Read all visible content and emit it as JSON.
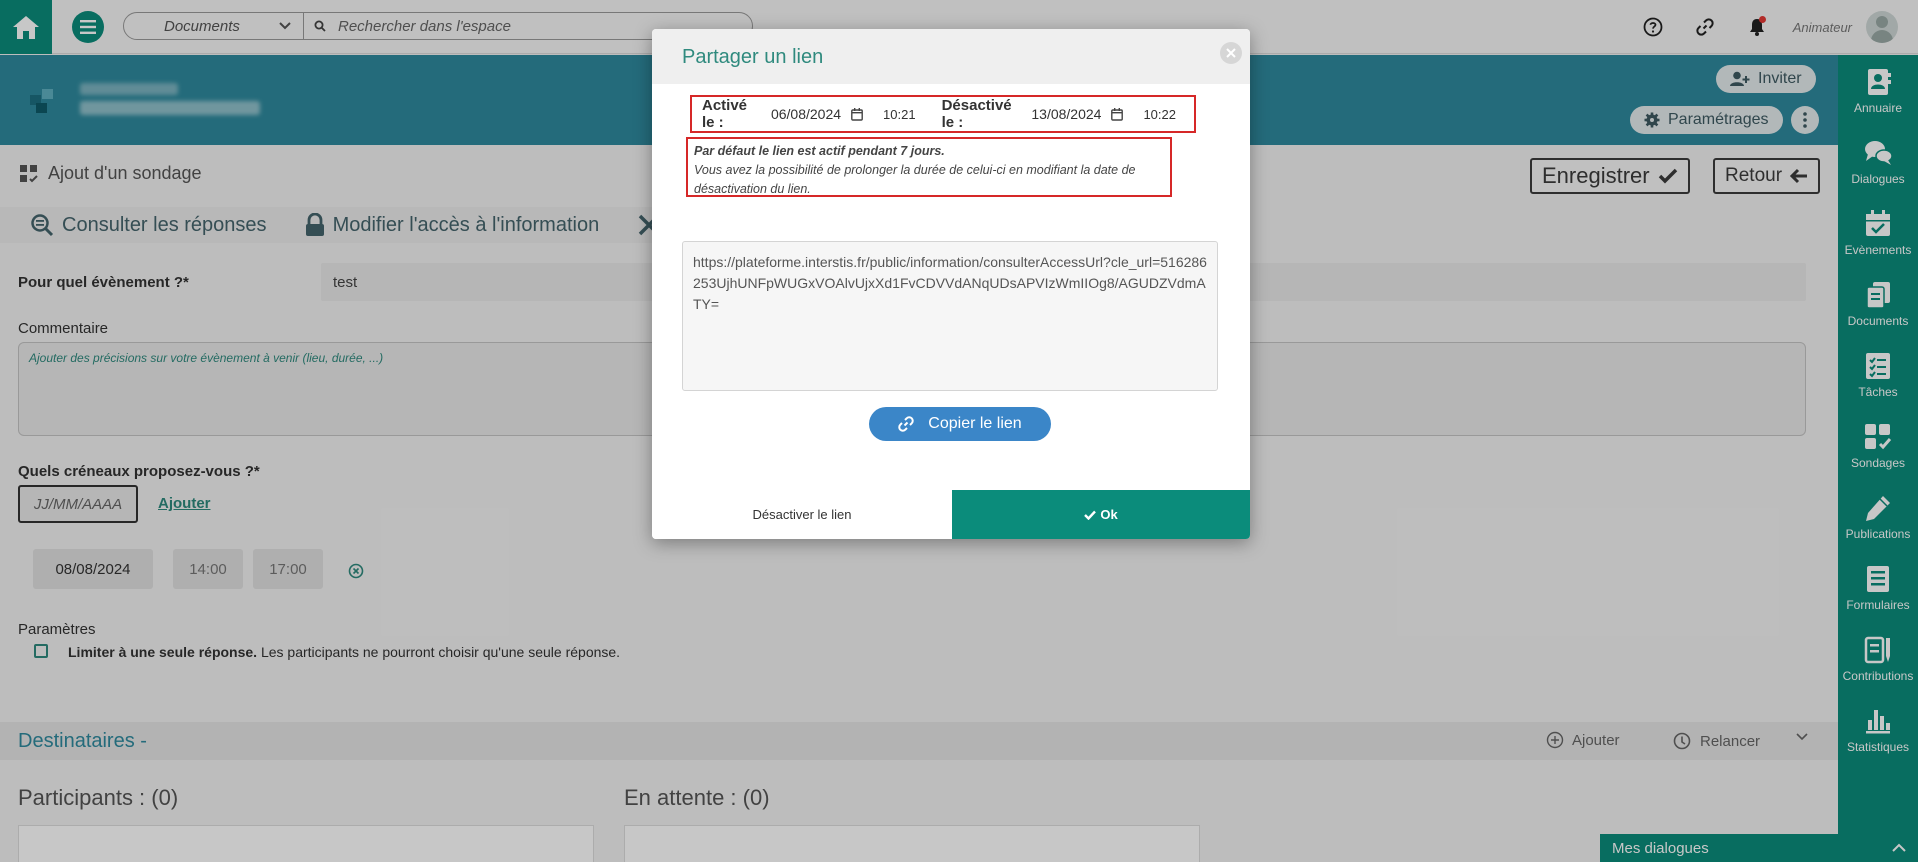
{
  "topbar": {
    "search_scope": "Documents",
    "search_placeholder": "Rechercher dans l'espace",
    "user_role": "Animateur"
  },
  "banner": {
    "invite_label": "Inviter",
    "settings_label": "Paramétrages"
  },
  "sidebar": {
    "items": [
      {
        "label": "Annuaire",
        "icon": "directory-icon"
      },
      {
        "label": "Dialogues",
        "icon": "chat-icon"
      },
      {
        "label": "Evènements",
        "icon": "calendar-icon"
      },
      {
        "label": "Documents",
        "icon": "documents-icon"
      },
      {
        "label": "Tâches",
        "icon": "tasks-icon"
      },
      {
        "label": "Sondages",
        "icon": "poll-icon"
      },
      {
        "label": "Publications",
        "icon": "pencil-icon"
      },
      {
        "label": "Formulaires",
        "icon": "form-icon"
      },
      {
        "label": "Contributions",
        "icon": "contributions-icon"
      },
      {
        "label": "Statistiques",
        "icon": "stats-icon"
      }
    ]
  },
  "page": {
    "section_title": "Ajout d'un sondage",
    "save_label": "Enregistrer",
    "back_label": "Retour",
    "tabs": {
      "responses": "Consulter les réponses",
      "access": "Modifier l'accès à l'information"
    },
    "event_label": "Pour quel évènement ?*",
    "event_value": "test",
    "comment_label": "Commentaire",
    "comment_placeholder": "Ajouter des précisions sur votre évènement à venir (lieu, durée, ...)",
    "slots_label": "Quels créneaux proposez-vous ?*",
    "date_placeholder": "JJ/MM/AAAA",
    "add_label": "Ajouter",
    "slot": {
      "date": "08/08/2024",
      "start": "14:00",
      "end": "17:00"
    },
    "params_label": "Paramètres",
    "limit_bold": "Limiter à une seule réponse.",
    "limit_text": " Les participants ne pourront choisir qu'une seule réponse.",
    "recipients_title": "Destinataires -",
    "recipients_add": "Ajouter",
    "recipients_remind": "Relancer",
    "participants_title": "Participants : (0)",
    "pending_title": "En attente : (0)",
    "dialogues_footer": "Mes dialogues"
  },
  "modal": {
    "title": "Partager un lien",
    "activated_label": "Activé le :",
    "activated_date": "06/08/2024",
    "activated_time": "10:21",
    "deactivated_label": "Désactivé le :",
    "deactivated_date": "13/08/2024",
    "deactivated_time": "10:22",
    "info_bold": "Par défaut le lien est actif pendant 7 jours.",
    "info_text": "Vous avez la possibilité de prolonger la durée de celui-ci en modifiant la date de désactivation du lien.",
    "url": "https://plateforme.interstis.fr/public/information/consulterAccessUrl?cle_url=516286253UjhUNFpWUGxVOAlvUjxXd1FvCDVVdANqUDsAPVIzWmIIOg8/AGUDZVdmATY=",
    "copy_label": "Copier le lien",
    "deactivate_label": "Désactiver le lien",
    "ok_label": "Ok"
  },
  "colors": {
    "primary": "#0b8c7b",
    "banner": "#2f8a9e",
    "highlight": "#d62828",
    "copy_button": "#3b86c8"
  }
}
